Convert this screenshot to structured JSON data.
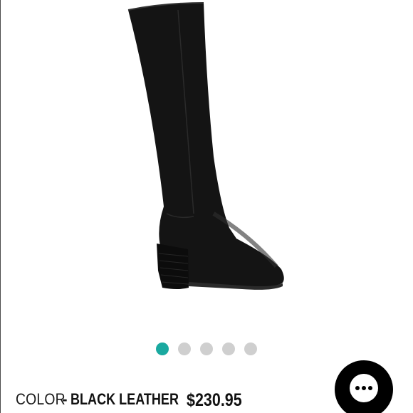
{
  "product": {
    "image_icon": "knee-high-black-leather-boot",
    "color_label": "COLOR",
    "color_separator": "-",
    "color_value": "BLACK LEATHER",
    "price": "$230.95"
  },
  "carousel": {
    "total_slides": 5,
    "active_index": 0,
    "active_color": "#1aa9a0",
    "inactive_color": "#cfcfcf"
  },
  "chat": {
    "icon": "chat-bubble-icon",
    "background": "#000000"
  }
}
